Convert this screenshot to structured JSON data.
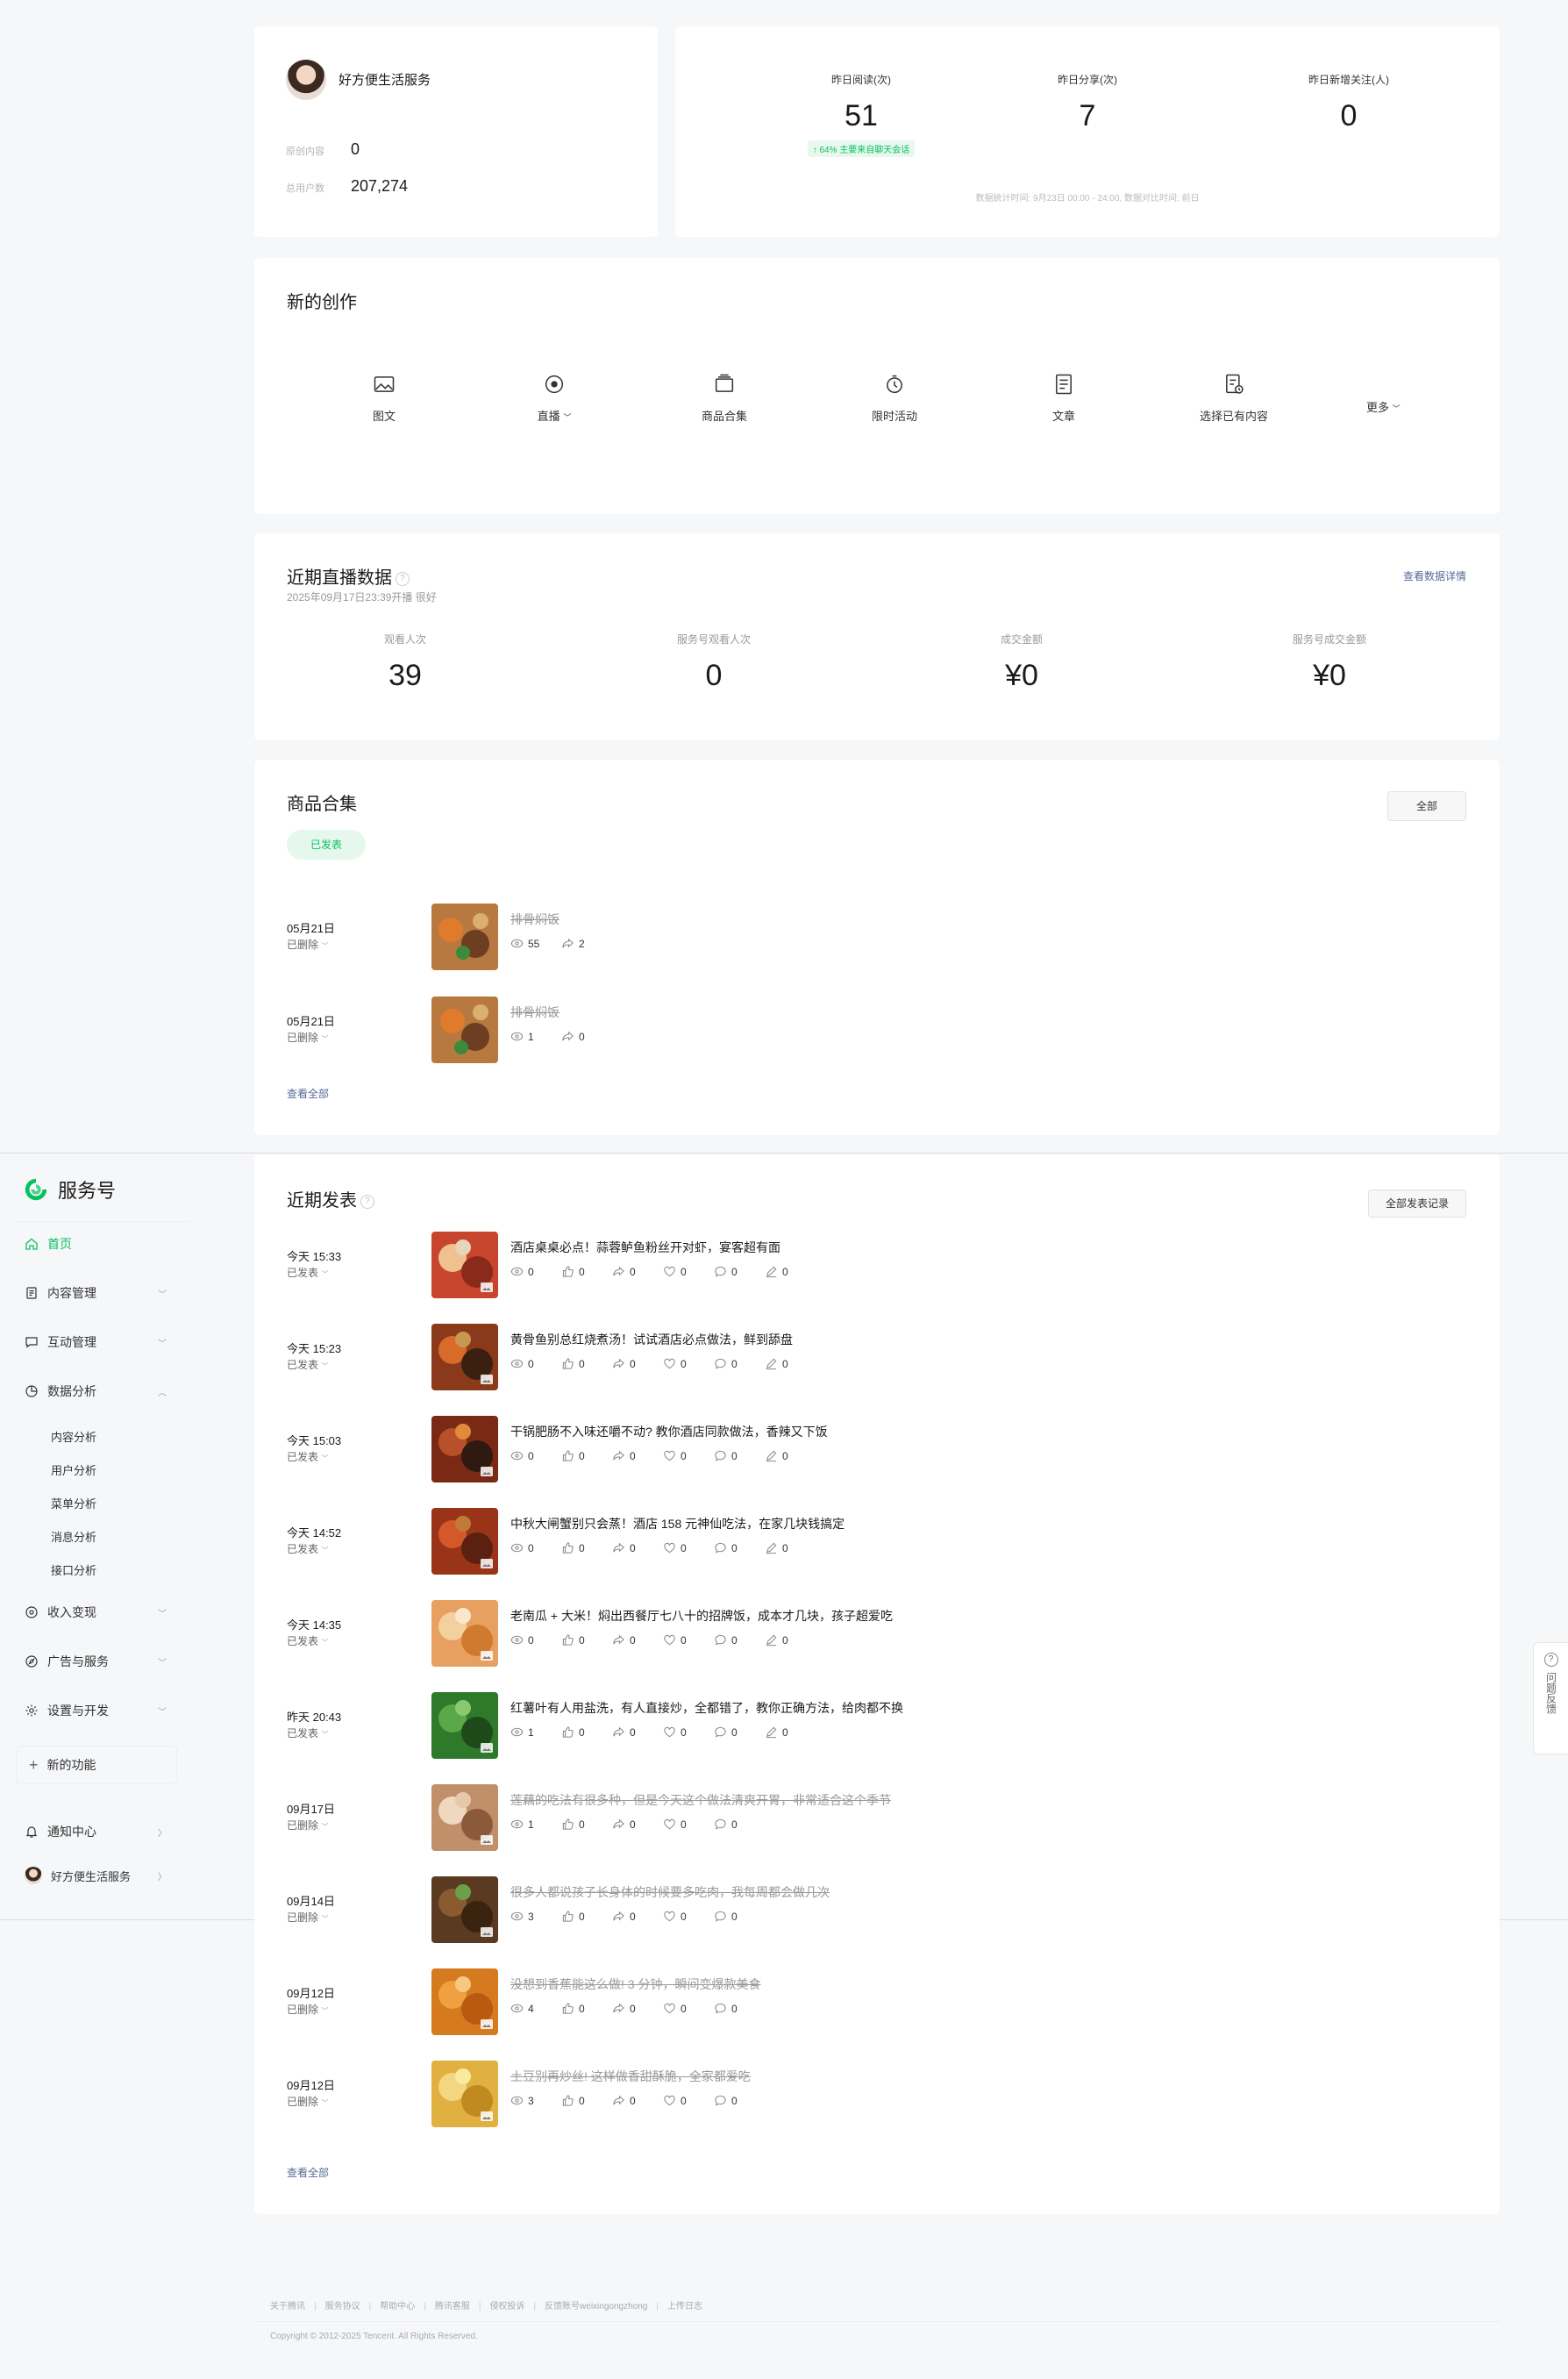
{
  "account": {
    "name": "好方便生活服务",
    "original_label": "原创内容",
    "original_value": "0",
    "users_label": "总用户数",
    "users_value": "207,274"
  },
  "stats": {
    "reads_label": "昨日阅读(次)",
    "reads_value": "51",
    "reads_tag": "↑ 64%  主要来自聊天会话",
    "shares_label": "昨日分享(次)",
    "shares_value": "7",
    "follows_label": "昨日新增关注(人)",
    "follows_value": "0",
    "note": "数据统计时间: 9月23日 00:00 - 24:00, 数据对比时间: 前日"
  },
  "create": {
    "title": "新的创作",
    "tools": [
      "图文",
      "直播",
      "商品合集",
      "限时活动",
      "文章",
      "选择已有内容"
    ],
    "more": "更多"
  },
  "live": {
    "title": "近期直播数据",
    "sub": "2025年09月17日23:39开播 很好",
    "detail": "查看数据详情",
    "items": [
      {
        "label": "观看人次",
        "value": "39"
      },
      {
        "label": "服务号观看人次",
        "value": "0"
      },
      {
        "label": "成交金额",
        "value": "¥0"
      },
      {
        "label": "服务号成交金额",
        "value": "¥0"
      }
    ]
  },
  "products": {
    "title": "商品合集",
    "all_btn": "全部",
    "tab": "已发表",
    "see_all": "查看全部",
    "items": [
      {
        "date": "05月21日",
        "state": "已删除",
        "title": "排骨焖饭",
        "views": "55",
        "shares": "2"
      },
      {
        "date": "05月21日",
        "state": "已删除",
        "title": "排骨焖饭",
        "views": "1",
        "shares": "0"
      }
    ]
  },
  "sidebar": {
    "brand": "服务号",
    "home": "首页",
    "content_mgmt": "内容管理",
    "interaction": "互动管理",
    "analytics": "数据分析",
    "sub": [
      "内容分析",
      "用户分析",
      "菜单分析",
      "消息分析",
      "接口分析"
    ],
    "income": "收入变现",
    "ads": "广告与服务",
    "settings": "设置与开发",
    "new_func": "新的功能",
    "notify": "通知中心",
    "account": "好方便生活服务"
  },
  "recent": {
    "title": "近期发表",
    "all_btn": "全部发表记录",
    "see_all": "查看全部",
    "posts": [
      {
        "date": "今天 15:33",
        "state": "已发表",
        "title": "酒店桌桌必点！蒜蓉鲈鱼粉丝开对虾，宴客超有面",
        "m": [
          "0",
          "0",
          "0",
          "0",
          "0",
          "0"
        ],
        "del": false
      },
      {
        "date": "今天 15:23",
        "state": "已发表",
        "title": "黄骨鱼别总红烧煮汤！试试酒店必点做法，鲜到舔盘",
        "m": [
          "0",
          "0",
          "0",
          "0",
          "0",
          "0"
        ],
        "del": false
      },
      {
        "date": "今天 15:03",
        "state": "已发表",
        "title": "干锅肥肠不入味还嚼不动? 教你酒店同款做法，香辣又下饭",
        "m": [
          "0",
          "0",
          "0",
          "0",
          "0",
          "0"
        ],
        "del": false
      },
      {
        "date": "今天 14:52",
        "state": "已发表",
        "title": "中秋大闸蟹别只会蒸！酒店 158 元神仙吃法，在家几块钱搞定",
        "m": [
          "0",
          "0",
          "0",
          "0",
          "0",
          "0"
        ],
        "del": false
      },
      {
        "date": "今天 14:35",
        "state": "已发表",
        "title": "老南瓜 + 大米！焖出西餐厅七八十的招牌饭，成本才几块，孩子超爱吃",
        "m": [
          "0",
          "0",
          "0",
          "0",
          "0",
          "0"
        ],
        "del": false
      },
      {
        "date": "昨天 20:43",
        "state": "已发表",
        "title": "红薯叶有人用盐洗，有人直接炒，全都错了，教你正确方法，给肉都不换",
        "m": [
          "1",
          "0",
          "0",
          "0",
          "0",
          "0"
        ],
        "del": false
      },
      {
        "date": "09月17日",
        "state": "已删除",
        "title": "莲藕的吃法有很多种，但是今天这个做法清爽开胃，非常适合这个季节",
        "m": [
          "1",
          "0",
          "0",
          "0",
          "0"
        ],
        "del": true
      },
      {
        "date": "09月14日",
        "state": "已删除",
        "title": "很多人都说孩子长身体的时候要多吃肉，我每周都会做几次",
        "m": [
          "3",
          "0",
          "0",
          "0",
          "0"
        ],
        "del": true
      },
      {
        "date": "09月12日",
        "state": "已删除",
        "title": "没想到香蕉能这么做! 3 分钟，瞬间变爆款美食",
        "m": [
          "4",
          "0",
          "0",
          "0",
          "0"
        ],
        "del": true
      },
      {
        "date": "09月12日",
        "state": "已删除",
        "title": "土豆别再炒丝! 这样做香甜酥脆，全家都爱吃",
        "m": [
          "3",
          "0",
          "0",
          "0",
          "0"
        ],
        "del": true
      }
    ]
  },
  "feedback": "问题反馈",
  "footer": {
    "links": [
      "关于腾讯",
      "服务协议",
      "帮助中心",
      "腾讯客服",
      "侵权投诉",
      "反馈账号weixingongzhong",
      "上传日志"
    ],
    "copyright": "Copyright © 2012-2025 Tencent. All Rights Reserved."
  },
  "colors": {
    "accent": "#07c160",
    "link": "#576b95",
    "bg": "#f6f7f9"
  }
}
